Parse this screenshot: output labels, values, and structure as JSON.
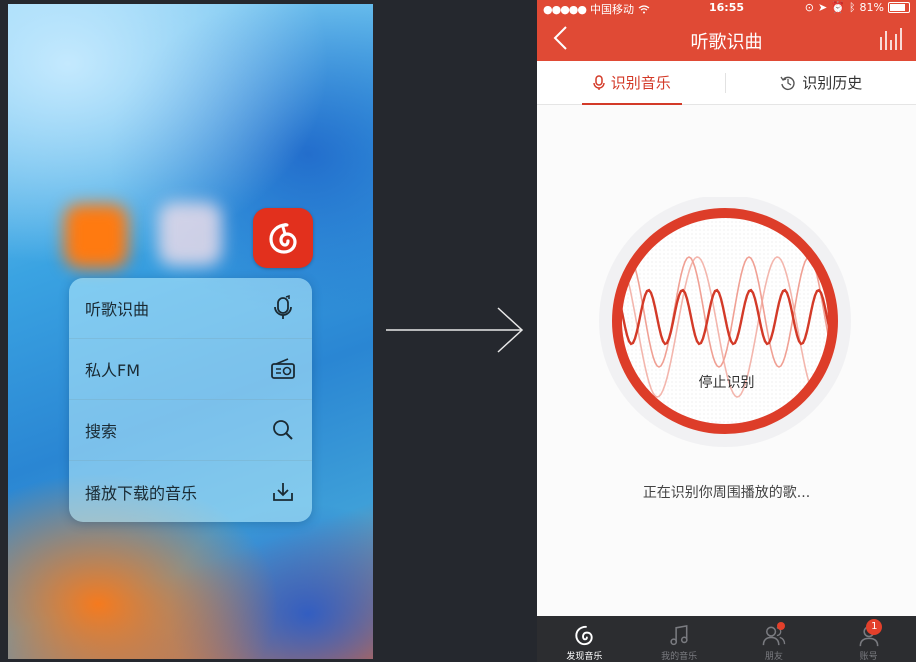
{
  "left_screen": {
    "quick_actions": [
      {
        "label": "听歌识曲",
        "icon": "mic-recognize-icon"
      },
      {
        "label": "私人FM",
        "icon": "radio-icon"
      },
      {
        "label": "搜索",
        "icon": "search-icon"
      },
      {
        "label": "播放下载的音乐",
        "icon": "download-icon"
      }
    ]
  },
  "right_screen": {
    "status_bar": {
      "carrier": "中国移动",
      "time": "16:55",
      "battery": "81%"
    },
    "nav": {
      "title": "听歌识曲"
    },
    "tabs": [
      {
        "label": "识别音乐",
        "icon": "mic-icon",
        "active": true
      },
      {
        "label": "识别历史",
        "icon": "history-icon",
        "active": false
      }
    ],
    "stop_button_label": "停止识别",
    "status_text": "正在识别你周围播放的歌...",
    "bottom_tabs": [
      {
        "label": "发现音乐",
        "icon": "netease-logo-icon",
        "active": true
      },
      {
        "label": "我的音乐",
        "icon": "music-note-icon",
        "active": false
      },
      {
        "label": "朋友",
        "icon": "friends-icon",
        "active": false,
        "dot": true
      },
      {
        "label": "账号",
        "icon": "account-icon",
        "active": false,
        "badge": "1"
      }
    ]
  },
  "colors": {
    "brand_red": "#e04a35",
    "accent_red": "#d33a28",
    "dark_bg": "#25282e"
  }
}
